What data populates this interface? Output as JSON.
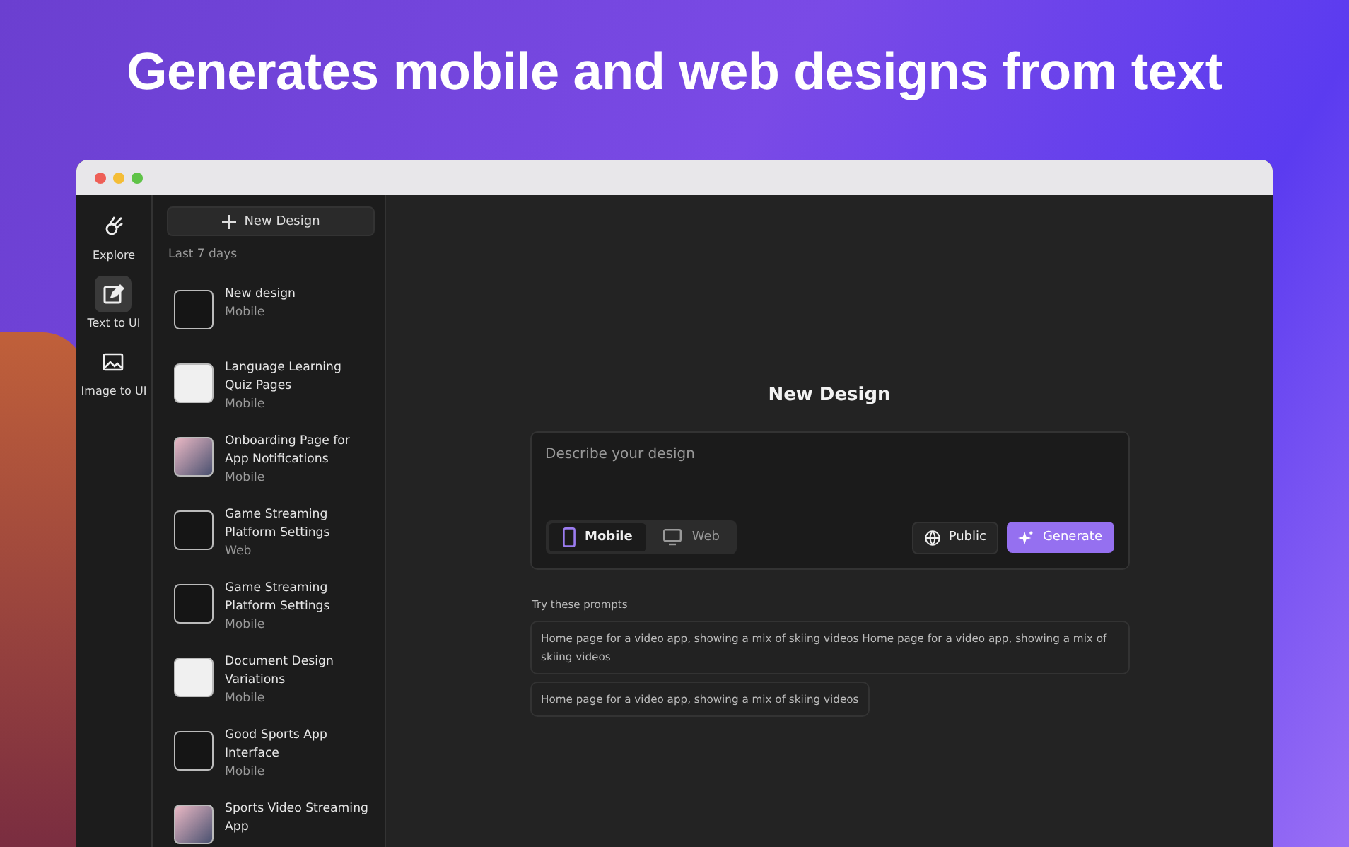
{
  "headline": "Generates mobile and web designs from text",
  "nav": [
    {
      "label": "Explore",
      "kind": "explore",
      "selected": false
    },
    {
      "label": "Text to UI",
      "kind": "edit",
      "selected": true
    },
    {
      "label": "Image to UI",
      "kind": "image",
      "selected": false
    }
  ],
  "sidebar": {
    "new_button": "New Design",
    "section": "Last 7 days",
    "items": [
      {
        "title": "New design",
        "type": "Mobile",
        "kind": "dark"
      },
      {
        "title": "Language Learning Quiz Pages",
        "type": "Mobile",
        "kind": "light"
      },
      {
        "title": "Onboarding Page for App Notifications",
        "type": "Mobile",
        "kind": "photo"
      },
      {
        "title": "Game Streaming Platform Settings",
        "type": "Web",
        "kind": "dark"
      },
      {
        "title": "Game Streaming Platform Settings",
        "type": "Mobile",
        "kind": "dark"
      },
      {
        "title": "Document Design Variations",
        "type": "Mobile",
        "kind": "light"
      },
      {
        "title": "Good Sports App Interface",
        "type": "Mobile",
        "kind": "dark"
      },
      {
        "title": "Sports Video Streaming App",
        "kind": "photo"
      }
    ]
  },
  "main": {
    "title": "New Design",
    "placeholder": "Describe your design",
    "platforms": [
      {
        "label": "Mobile",
        "kind": "phone",
        "selected": true
      },
      {
        "label": "Web",
        "kind": "monitor",
        "selected": false
      }
    ],
    "visibility": "Public",
    "generate": "Generate",
    "prompts_label": "Try these prompts",
    "prompts": [
      "Home page for a video app, showing a mix of skiing videos Home page for a video app, showing a mix of skiing videos",
      "Home page for a video app, showing a mix of skiing videos"
    ]
  }
}
